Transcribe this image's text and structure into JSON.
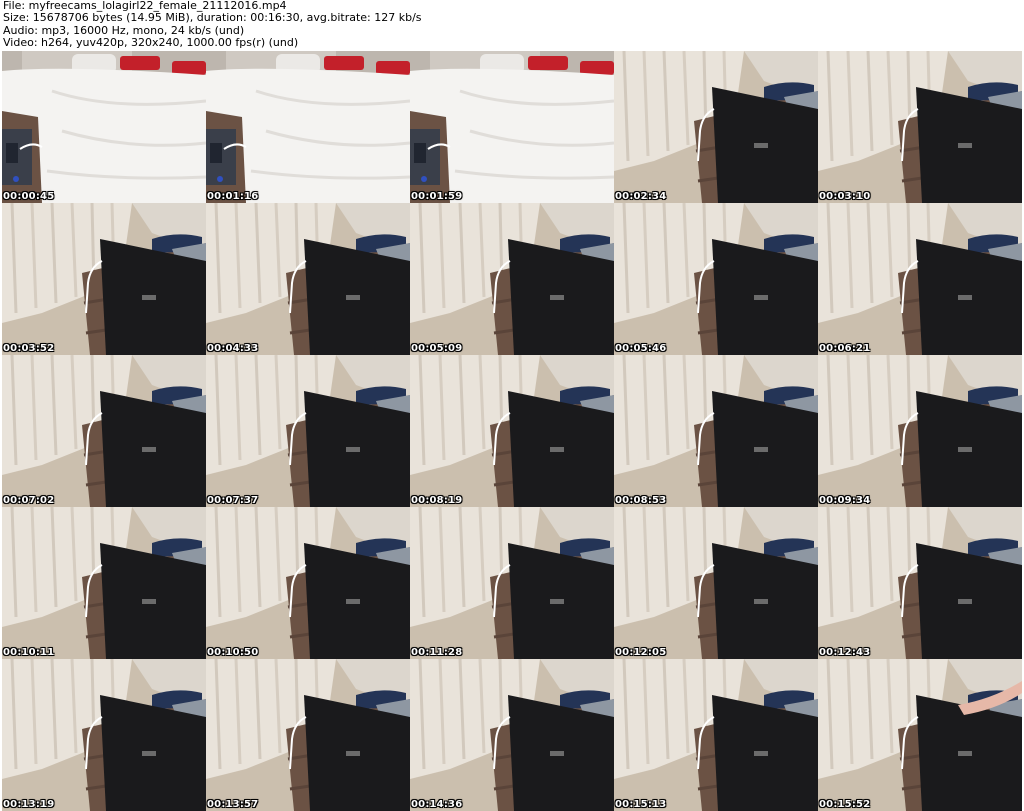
{
  "header": {
    "file_line": "File: myfreecams_lolagirl22_female_21112016.mp4",
    "size_line": "Size: 15678706 bytes (14.95 MiB), duration: 00:16:30, avg.bitrate: 127 kb/s",
    "audio_line": "Audio: mp3, 16000 Hz, mono, 24 kb/s (und)",
    "video_line": "Video: h264, yuv420p, 320x240, 1000.00 fps(r) (und)"
  },
  "thumbnails": [
    {
      "timestamp": "00:00:45",
      "scene": "bed"
    },
    {
      "timestamp": "00:01:16",
      "scene": "bed"
    },
    {
      "timestamp": "00:01:59",
      "scene": "bed"
    },
    {
      "timestamp": "00:02:34",
      "scene": "laptop"
    },
    {
      "timestamp": "00:03:10",
      "scene": "laptop"
    },
    {
      "timestamp": "00:03:52",
      "scene": "laptop"
    },
    {
      "timestamp": "00:04:33",
      "scene": "laptop"
    },
    {
      "timestamp": "00:05:09",
      "scene": "laptop"
    },
    {
      "timestamp": "00:05:46",
      "scene": "laptop"
    },
    {
      "timestamp": "00:06:21",
      "scene": "laptop"
    },
    {
      "timestamp": "00:07:02",
      "scene": "laptop"
    },
    {
      "timestamp": "00:07:37",
      "scene": "laptop"
    },
    {
      "timestamp": "00:08:19",
      "scene": "laptop"
    },
    {
      "timestamp": "00:08:53",
      "scene": "laptop"
    },
    {
      "timestamp": "00:09:34",
      "scene": "laptop"
    },
    {
      "timestamp": "00:10:11",
      "scene": "laptop"
    },
    {
      "timestamp": "00:10:50",
      "scene": "laptop"
    },
    {
      "timestamp": "00:11:28",
      "scene": "laptop"
    },
    {
      "timestamp": "00:12:05",
      "scene": "laptop"
    },
    {
      "timestamp": "00:12:43",
      "scene": "laptop"
    },
    {
      "timestamp": "00:13:19",
      "scene": "laptop"
    },
    {
      "timestamp": "00:13:57",
      "scene": "laptop"
    },
    {
      "timestamp": "00:14:36",
      "scene": "laptop"
    },
    {
      "timestamp": "00:15:13",
      "scene": "laptop"
    },
    {
      "timestamp": "00:15:52",
      "scene": "laptop-arm"
    }
  ],
  "colors": {
    "background": "#ffffff",
    "timestamp_text": "#ffffff",
    "curtain": "#e6dfd6",
    "carpet": "#cbbfae",
    "furniture": "#6b5244",
    "laptop": "#1a1a1c"
  }
}
